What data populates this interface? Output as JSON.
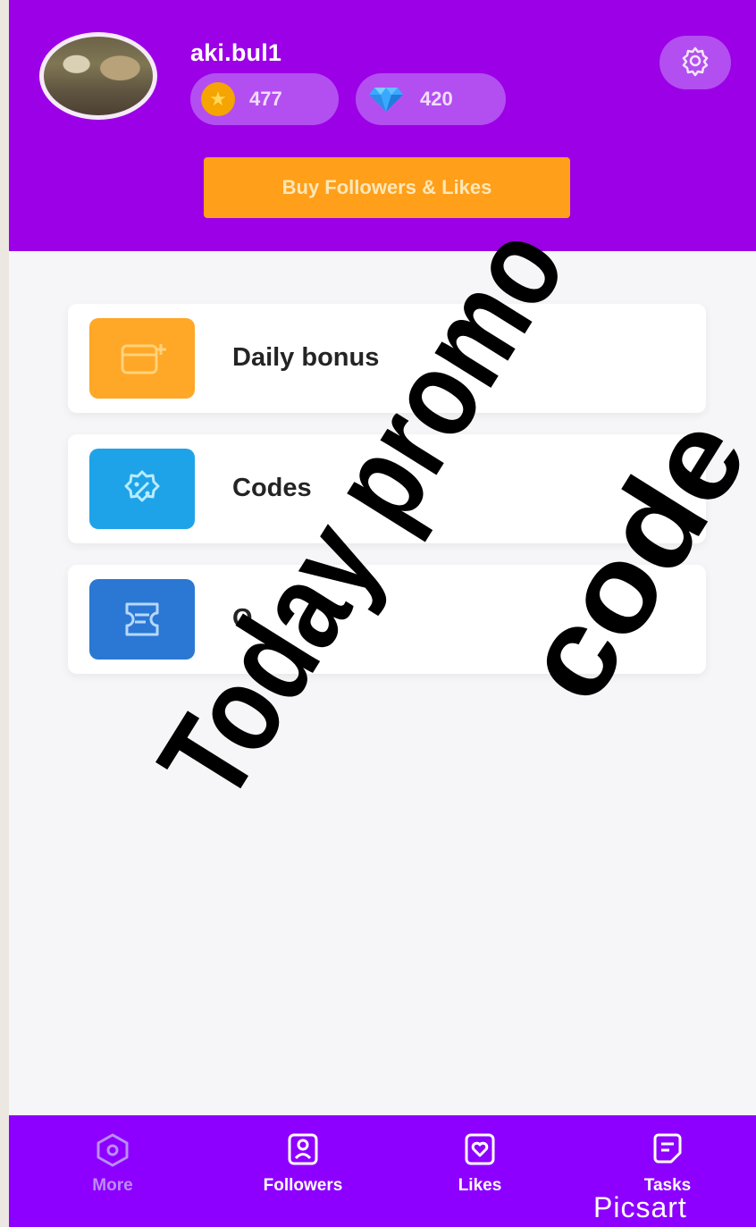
{
  "profile": {
    "username": "aki.bul1",
    "coins": "477",
    "gems": "420"
  },
  "header": {
    "buy_label": "Buy Followers & Likes"
  },
  "menu": [
    {
      "label": "Daily bonus",
      "icon": "calendar-plus-icon",
      "color": "#ffa726"
    },
    {
      "label": "Codes",
      "icon": "discount-badge-icon",
      "color": "#1fa3e8"
    },
    {
      "label": "O",
      "icon": "ticket-icon",
      "color": "#2a78d3"
    }
  ],
  "watermark": {
    "line1": "Today promo",
    "line2": "code"
  },
  "nav": {
    "more": "More",
    "followers": "Followers",
    "likes": "Likes",
    "tasks": "Tasks"
  },
  "brand": "Picsart",
  "colors": {
    "header": "#9c00e6",
    "nav": "#8d00ff",
    "button": "#ff9f1a"
  }
}
